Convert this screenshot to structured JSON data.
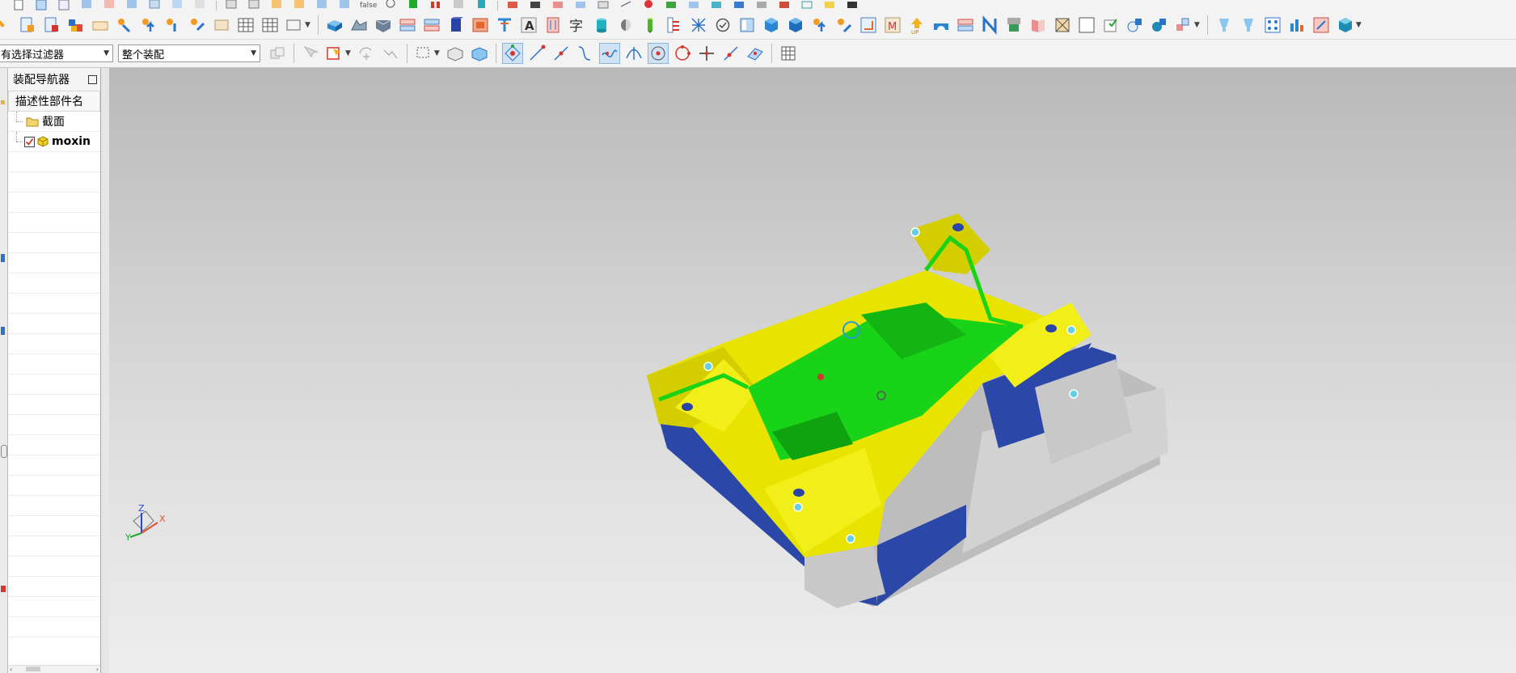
{
  "toolbar": {
    "row1_fragment_text": "false",
    "selection_filter": {
      "value": "有选择过滤器"
    },
    "assembly_scope": {
      "value": "整个装配"
    }
  },
  "navigator": {
    "title": "装配导航器",
    "column_header": "描述性部件名",
    "items": [
      {
        "label": "截面",
        "icon": "folder-icon"
      },
      {
        "label": "moxin",
        "icon": "component-icon",
        "checked": true
      }
    ]
  },
  "viewport": {
    "triad": {
      "x_label": "X",
      "y_label": "Y",
      "z_label": "Z"
    },
    "colors": {
      "yellow": "#e8e400",
      "green": "#19d319",
      "blue": "#2a44a6",
      "gray": "#c6c6c6"
    }
  }
}
